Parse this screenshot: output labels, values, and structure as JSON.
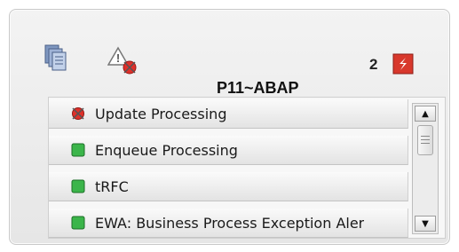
{
  "header": {
    "count": "2",
    "system_title": "P11~ABAP"
  },
  "icons": {
    "copy": "copy-icon",
    "alert": "alert-warning-icon",
    "app": "app-logo-icon"
  },
  "rows": [
    {
      "label": "Update Processing",
      "status": "error"
    },
    {
      "label": "Enqueue Processing",
      "status": "ok"
    },
    {
      "label": "tRFC",
      "status": "ok"
    },
    {
      "label": "EWA: Business Process Exception Aler",
      "status": "ok"
    }
  ],
  "scrollbar": {
    "up": "▲",
    "down": "▼"
  },
  "colors": {
    "ok": "#3bb54a",
    "error": "#e0302a",
    "accent": "#d8382c"
  }
}
